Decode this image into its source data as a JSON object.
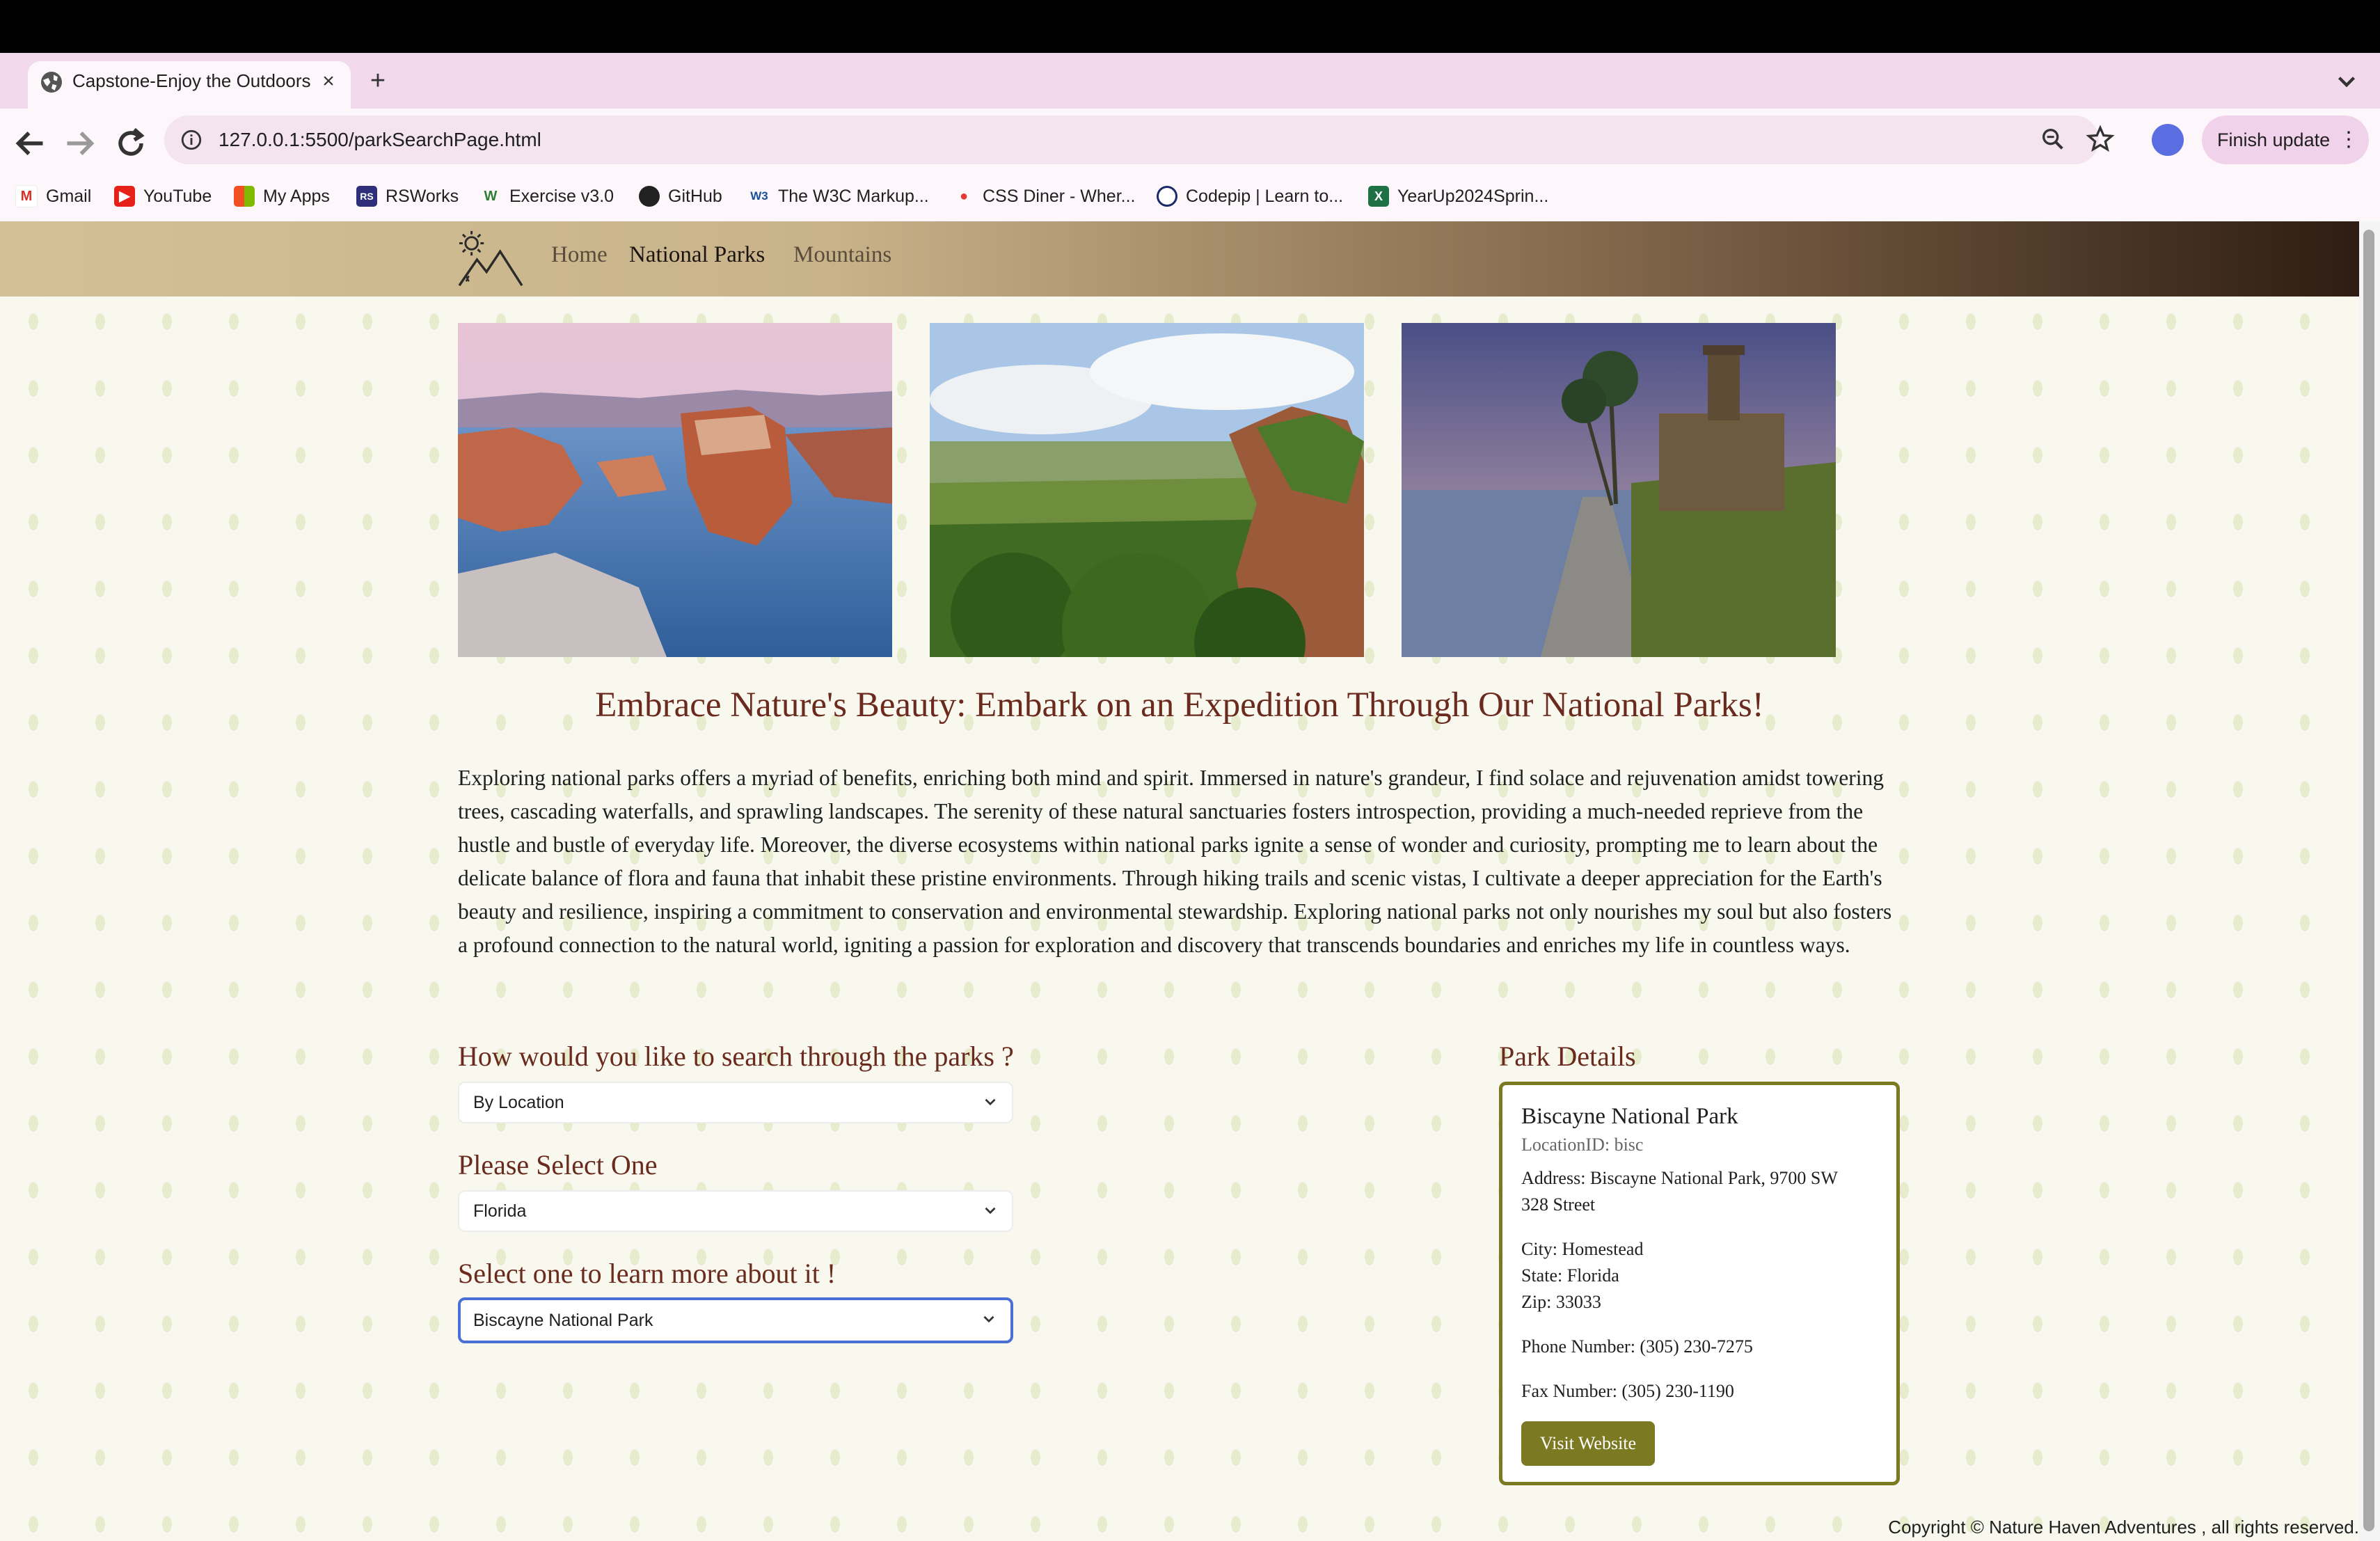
{
  "browser": {
    "tab_title": "Capstone-Enjoy the Outdoors",
    "tab_close": "×",
    "new_tab": "+",
    "url": "127.0.0.1:5500/parkSearchPage.html",
    "finish_update": "Finish update",
    "bookmarks": [
      {
        "label": "Gmail",
        "icon": "gmail-icon"
      },
      {
        "label": "YouTube",
        "icon": "youtube-icon"
      },
      {
        "label": "My Apps",
        "icon": "apps-grid-icon"
      },
      {
        "label": "RSWorks",
        "icon": "rsworks-icon"
      },
      {
        "label": "Exercise v3.0",
        "icon": "w-icon"
      },
      {
        "label": "GitHub",
        "icon": "github-icon"
      },
      {
        "label": "The W3C Markup...",
        "icon": "w3c-icon"
      },
      {
        "label": "CSS Diner - Wher...",
        "icon": "css-diner-icon"
      },
      {
        "label": "Codepip | Learn to...",
        "icon": "codepip-icon"
      },
      {
        "label": "YearUp2024Sprin...",
        "icon": "excel-icon"
      }
    ]
  },
  "site": {
    "nav": {
      "home": "Home",
      "national_parks": "National Parks",
      "mountains": "Mountains"
    },
    "heading": "Embrace Nature's Beauty: Embark on an Expedition Through Our National Parks!",
    "intro": "Exploring national parks offers a myriad of benefits, enriching both mind and spirit. Immersed in nature's grandeur, I find solace and rejuvenation amidst towering trees, cascading waterfalls, and sprawling landscapes. The serenity of these natural sanctuaries fosters introspection, providing a much-needed reprieve from the hustle and bustle of everyday life. Moreover, the diverse ecosystems within national parks ignite a sense of wonder and curiosity, prompting me to learn about the delicate balance of flora and fauna that inhabit these pristine environments. Through hiking trails and scenic vistas, I cultivate a deeper appreciation for the Earth's beauty and resilience, inspiring a commitment to conservation and environmental stewardship. Exploring national parks not only nourishes my soul but also fosters a profound connection to the natural world, igniting a passion for exploration and discovery that transcends boundaries and enriches my life in countless ways.",
    "search": {
      "q1_label": "How would you like to search through the parks ?",
      "q1_value": "By Location",
      "q2_label": "Please Select One",
      "q2_value": "Florida",
      "q3_label": "Select one to learn more about it !",
      "q3_value": "Biscayne National Park"
    },
    "details": {
      "heading": "Park Details",
      "name": "Biscayne National Park",
      "location_id": "LocationID: bisc",
      "address_line1": "Address: Biscayne National Park, 9700 SW",
      "address_line2": "328 Street",
      "city": "City: Homestead",
      "state": "State: Florida",
      "zip": "Zip: 33033",
      "phone": "Phone Number: (305) 230-7275",
      "fax": "Fax Number: (305) 230-1190",
      "visit_button": "Visit Website"
    },
    "copyright": "Copyright © Nature Haven Adventures , all rights reserved."
  }
}
